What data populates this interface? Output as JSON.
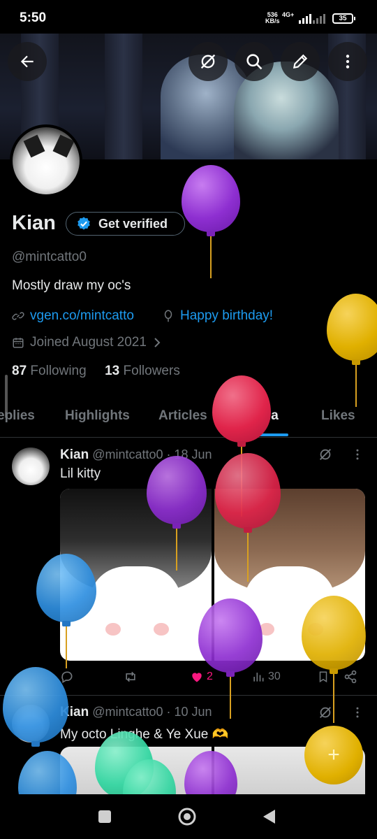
{
  "status": {
    "time": "5:50",
    "net_speed_top": "536",
    "net_speed_unit": "KB/s",
    "net_type": "4G+",
    "battery": "35"
  },
  "profile": {
    "name": "Kian",
    "verify_label": "Get verified",
    "handle": "@mintcatto0",
    "bio": "Mostly draw my oc's",
    "website": "vgen.co/mintcatto",
    "birthday": "Happy birthday!",
    "joined": "Joined August 2021",
    "following_count": "87",
    "following_label": "Following",
    "followers_count": "13",
    "followers_label": "Followers"
  },
  "tabs": [
    "eplies",
    "Highlights",
    "Articles",
    "Media",
    "Likes"
  ],
  "active_tab": "Media",
  "posts": [
    {
      "name": "Kian",
      "handle": "@mintcatto0",
      "date": "· 18 Jun",
      "text": "Lil kitty",
      "likes": "2",
      "views": "30"
    },
    {
      "name": "Kian",
      "handle": "@mintcatto0",
      "date": "· 10 Jun",
      "text": "My octo Linghe & Ye Xue 🫶"
    }
  ],
  "fab_symbol": "+",
  "colors": {
    "accent": "#1d9bf0",
    "like": "#f91880",
    "muted": "#71767b",
    "text": "#e7e9ea",
    "balloon_purple": "#8e2fd1",
    "balloon_gold": "#e0b000",
    "balloon_red": "#e0244a",
    "balloon_blue": "#2f8fe0",
    "balloon_green": "#2fd6a0"
  },
  "icons": [
    "back-arrow-icon",
    "grok-icon",
    "search-icon",
    "edit-icon",
    "more-vertical-icon",
    "verified-badge-icon",
    "link-icon",
    "balloon-icon",
    "calendar-icon",
    "chevron-right-icon",
    "reply-icon",
    "repost-icon",
    "heart-icon",
    "views-icon",
    "bookmark-icon",
    "share-icon",
    "nav-square-icon",
    "nav-home-icon",
    "nav-back-icon"
  ]
}
